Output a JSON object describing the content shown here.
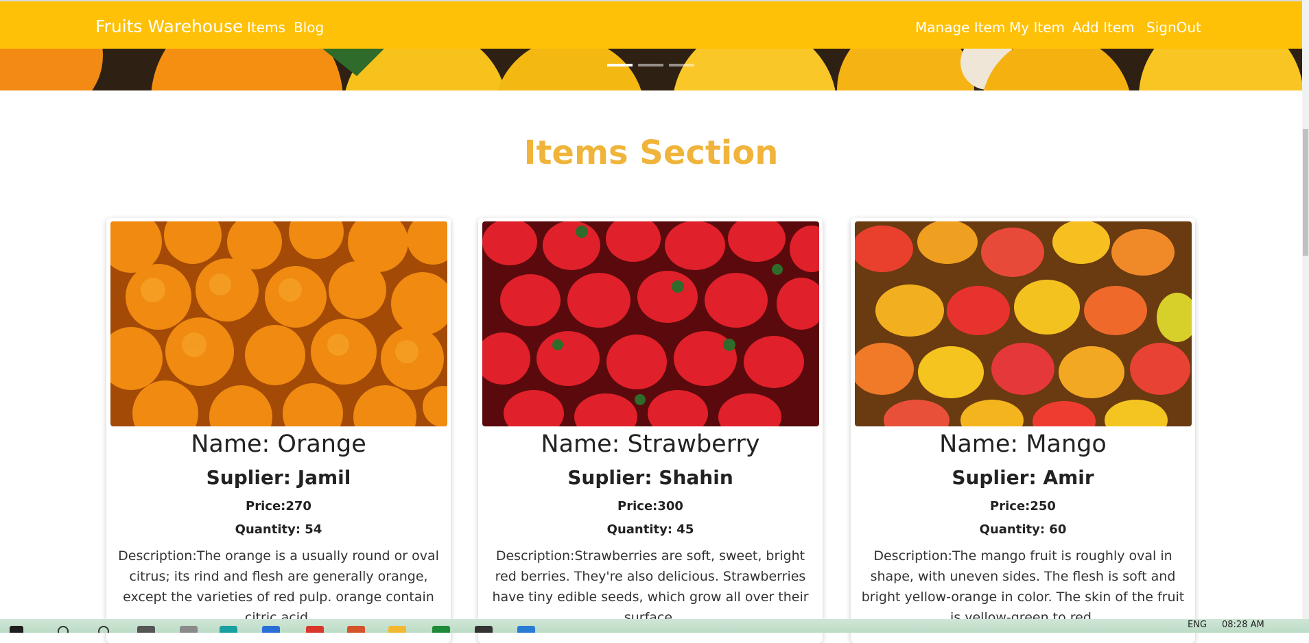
{
  "nav": {
    "brand": "Fruits Warehouse",
    "left_links": [
      "Items",
      "Blog"
    ],
    "right_links": [
      "Manage Item",
      "My Item",
      "Add Item",
      "SignOut"
    ],
    "accent": "#ffc107"
  },
  "hero": {
    "slides": 3,
    "active_slide": 1
  },
  "section": {
    "title": "Items Section",
    "title_color": "#f0b43a"
  },
  "items": [
    {
      "name": "Name: Orange",
      "supplier": "Suplier: Jamil",
      "price": "Price:270",
      "quantity": "Quantity: 54",
      "description": "Description:The orange is a usually round or oval citrus; its rind and flesh are generally orange, except the varieties of red pulp. orange contain citric acid."
    },
    {
      "name": "Name: Strawberry",
      "supplier": "Suplier: Shahin",
      "price": "Price:300",
      "quantity": "Quantity: 45",
      "description": "Description:Strawberries are soft, sweet, bright red berries. They're also delicious. Strawberries have tiny edible seeds, which grow all over their surface."
    },
    {
      "name": "Name: Mango",
      "supplier": "Suplier: Amir",
      "price": "Price:250",
      "quantity": "Quantity: 60",
      "description": "Description:The mango fruit is roughly oval in shape, with uneven sides. The flesh is soft and bright yellow-orange in color. The skin of the fruit is yellow-green to red."
    }
  ],
  "taskbar": {
    "language": "ENG",
    "time": "08:28 AM"
  }
}
